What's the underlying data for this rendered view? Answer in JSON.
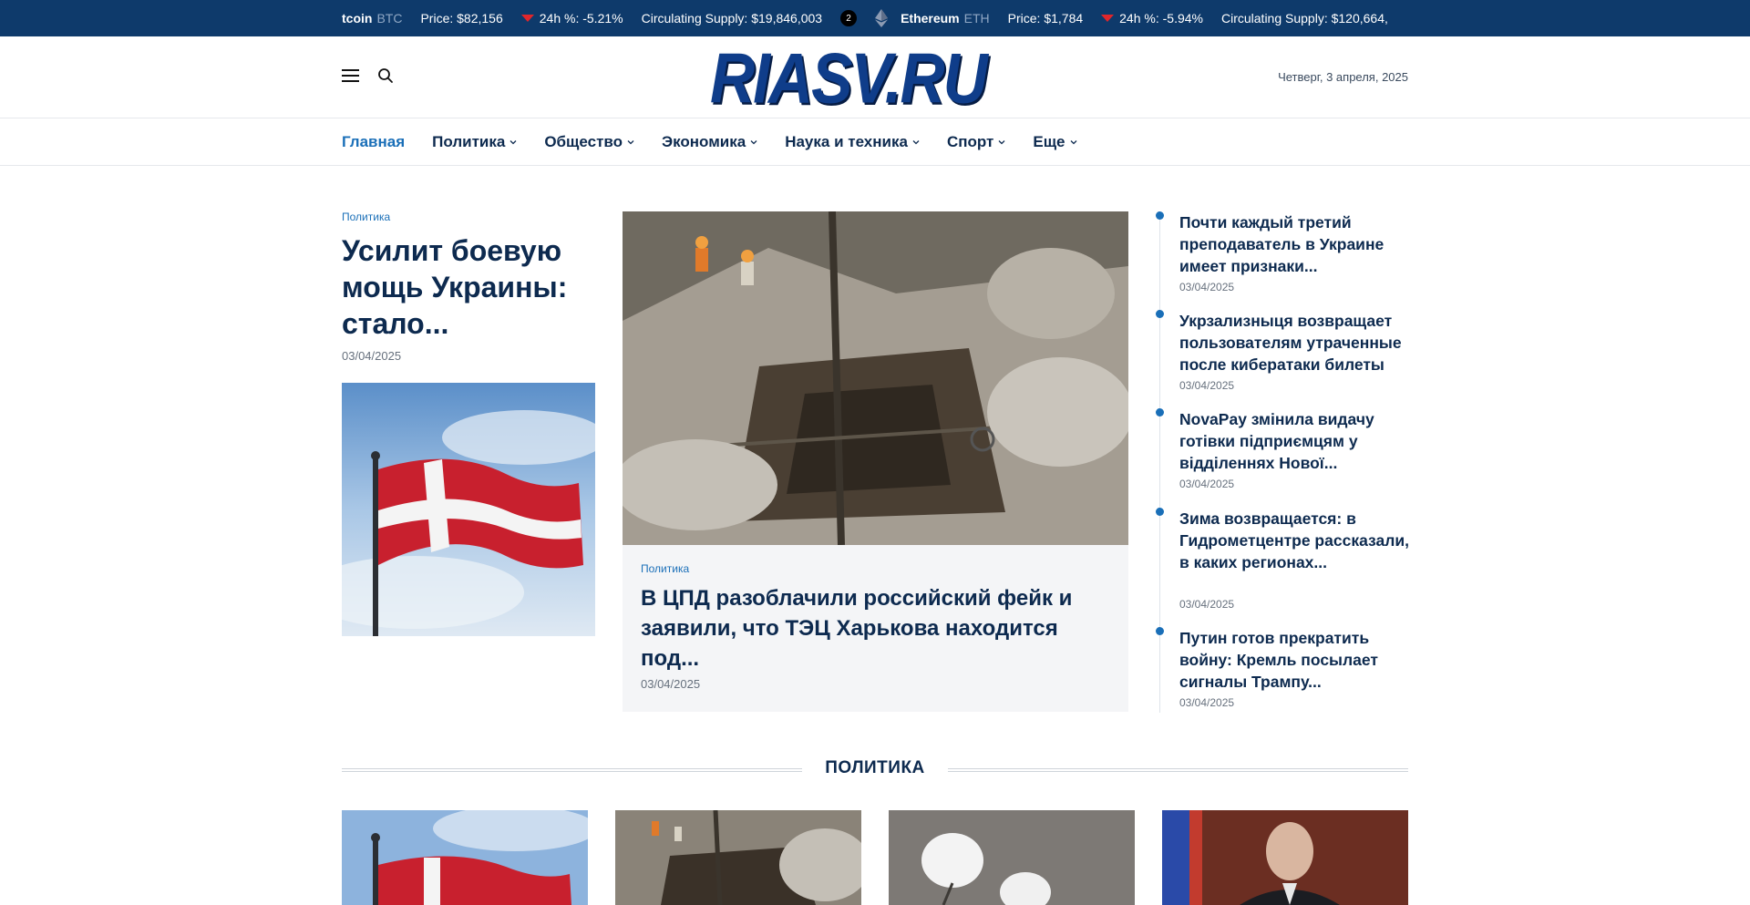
{
  "ticker": {
    "items": [
      {
        "name": "tcoin",
        "symbol": "BTC",
        "price": "Price: $82,156",
        "change": "24h %: -5.21%",
        "supply": "Circulating Supply: $19,846,003",
        "badge": "2"
      },
      {
        "name": "Ethereum",
        "symbol": "ETH",
        "price": "Price: $1,784",
        "change": "24h %: -5.94%",
        "supply": "Circulating Supply: $120,664,"
      }
    ]
  },
  "header": {
    "logo_text": "RIASV.RU",
    "date": "Четверг, 3 апреля, 2025",
    "menu_icon": "hamburger-icon",
    "search_icon": "search-icon"
  },
  "nav": {
    "items": [
      {
        "label": "Главная",
        "active": true
      },
      {
        "label": "Политика"
      },
      {
        "label": "Общество"
      },
      {
        "label": "Экономика"
      },
      {
        "label": "Наука и техника"
      },
      {
        "label": "Спорт"
      },
      {
        "label": "Еще"
      }
    ]
  },
  "lead_left": {
    "category": "Политика",
    "title": "Усилит боевую мощь Украины: стало...",
    "date": "03/04/2025"
  },
  "lead_center": {
    "category": "Политика",
    "title": "В ЦПД разоблачили российский фейк и заявили, что ТЭЦ Харькова находится под...",
    "date": "03/04/2025"
  },
  "side_list": [
    {
      "title": "Почти каждый третий преподаватель в Украине имеет признаки...",
      "date": "03/04/2025"
    },
    {
      "title": "Укрзализныця возвращает пользователям утраченные после кибератаки билеты",
      "date": "03/04/2025"
    },
    {
      "title": "NovaPay змінила видачу готівки підприємцям у відділеннях Нової...",
      "date": "03/04/2025"
    },
    {
      "title": "Зима возвращается: в Гидрометцентре рассказали, в каких регионах...",
      "date": "03/04/2025"
    },
    {
      "title": "Путин готов прекратить войну: Кремль посылает сигналы Трампу...",
      "date": "03/04/2025"
    }
  ],
  "section": {
    "title": "ПОЛИТИКА"
  },
  "colors": {
    "ticker_bg": "#0e3a6b",
    "accent": "#1a6fb8",
    "heading": "#0d2a4f",
    "down": "#e0262b"
  }
}
